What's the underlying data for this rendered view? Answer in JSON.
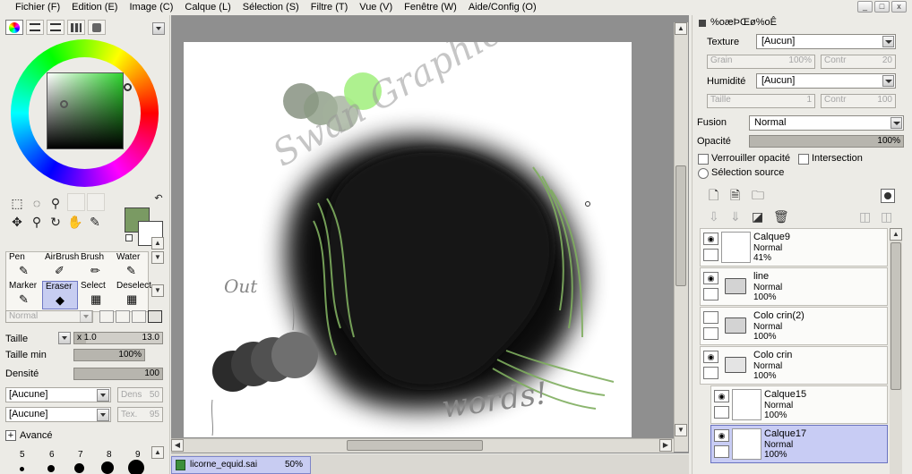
{
  "menu": [
    "Fichier (F)",
    "Edition (E)",
    "Image (C)",
    "Calque (L)",
    "Sélection (S)",
    "Filtre (T)",
    "Vue (V)",
    "Fenêtre (W)",
    "Aide/Config (O)"
  ],
  "window_buttons": [
    "_",
    "□",
    "x"
  ],
  "tools": {
    "brushes": [
      {
        "label": "Pen",
        "icon": "pen-icon",
        "glyph": "✎"
      },
      {
        "label": "AirBrush",
        "icon": "airbrush-icon",
        "glyph": "✐"
      },
      {
        "label": "Brush",
        "icon": "brush-icon",
        "glyph": "✏"
      },
      {
        "label": "Water",
        "icon": "water-brush-icon",
        "glyph": "✎"
      },
      {
        "label": "Marker",
        "icon": "marker-icon",
        "glyph": "✎"
      },
      {
        "label": "Eraser",
        "icon": "eraser-icon",
        "glyph": "◆"
      },
      {
        "label": "Select",
        "icon": "select-brush-icon",
        "glyph": "▦"
      },
      {
        "label": "Deselect",
        "icon": "deselect-brush-icon",
        "glyph": "▦"
      }
    ],
    "selected_brush": "Eraser",
    "blend_mode": "Normal",
    "taille_label": "Taille",
    "taille_multiplier": "x 1.0",
    "taille_value": "13.0",
    "taille_min_label": "Taille min",
    "taille_min_value": "100%",
    "densite_label": "Densité",
    "densite_value": "100",
    "texture_combo": "[Aucune]",
    "texture_field_label": "Dens",
    "texture_field_value": "50",
    "shape_combo": "[Aucune]",
    "shape_field_label": "Tex.",
    "shape_field_value": "95",
    "avance_label": "Avancé",
    "avance_toggle": "+",
    "brush_sizes": [
      "5",
      "6",
      "7",
      "8",
      "9"
    ]
  },
  "colors": {
    "foreground": "#7a9a63",
    "background": "#ffffff",
    "wheel_hue": "#2fd52f"
  },
  "document": {
    "tab_name": "licorne_equid.sai",
    "zoom": "50%"
  },
  "layer_panel": {
    "header_title": "%oæÞŒø%oÊ",
    "texture_label": "Texture",
    "texture_value": "[Aucun]",
    "grain_label": "Grain",
    "grain_value": "100%",
    "contr_label": "Contr",
    "contr_value": "20",
    "humidite_label": "Humidité",
    "humidite_value": "[Aucun]",
    "taille_label": "Taille",
    "taille_value": "1",
    "contr2_label": "Contr",
    "contr2_value": "100",
    "fusion_label": "Fusion",
    "fusion_value": "Normal",
    "opacite_label": "Opacité",
    "opacite_value": "100%",
    "verrouiller_label": "Verrouiller opacité",
    "intersection_label": "Intersection",
    "selection_source_label": "Sélection source"
  },
  "layers": [
    {
      "name": "Calque9",
      "mode": "Normal",
      "opacity": "41%",
      "type": "layer",
      "visible": true
    },
    {
      "name": "line",
      "mode": "Normal",
      "opacity": "100%",
      "type": "folder",
      "visible": true
    },
    {
      "name": "Colo crin(2)",
      "mode": "Normal",
      "opacity": "100%",
      "type": "folder",
      "visible": false
    },
    {
      "name": "Colo crin",
      "mode": "Normal",
      "opacity": "100%",
      "type": "folder-open",
      "visible": true
    },
    {
      "name": "Calque15",
      "mode": "Normal",
      "opacity": "100%",
      "type": "layer",
      "visible": true
    },
    {
      "name": "Calque17",
      "mode": "Normal",
      "opacity": "100%",
      "type": "layer",
      "visible": true,
      "selected": true
    }
  ],
  "canvas_text": {
    "out_label": "Out",
    "watermark": "Swan Graphic",
    "signature": "words!"
  }
}
